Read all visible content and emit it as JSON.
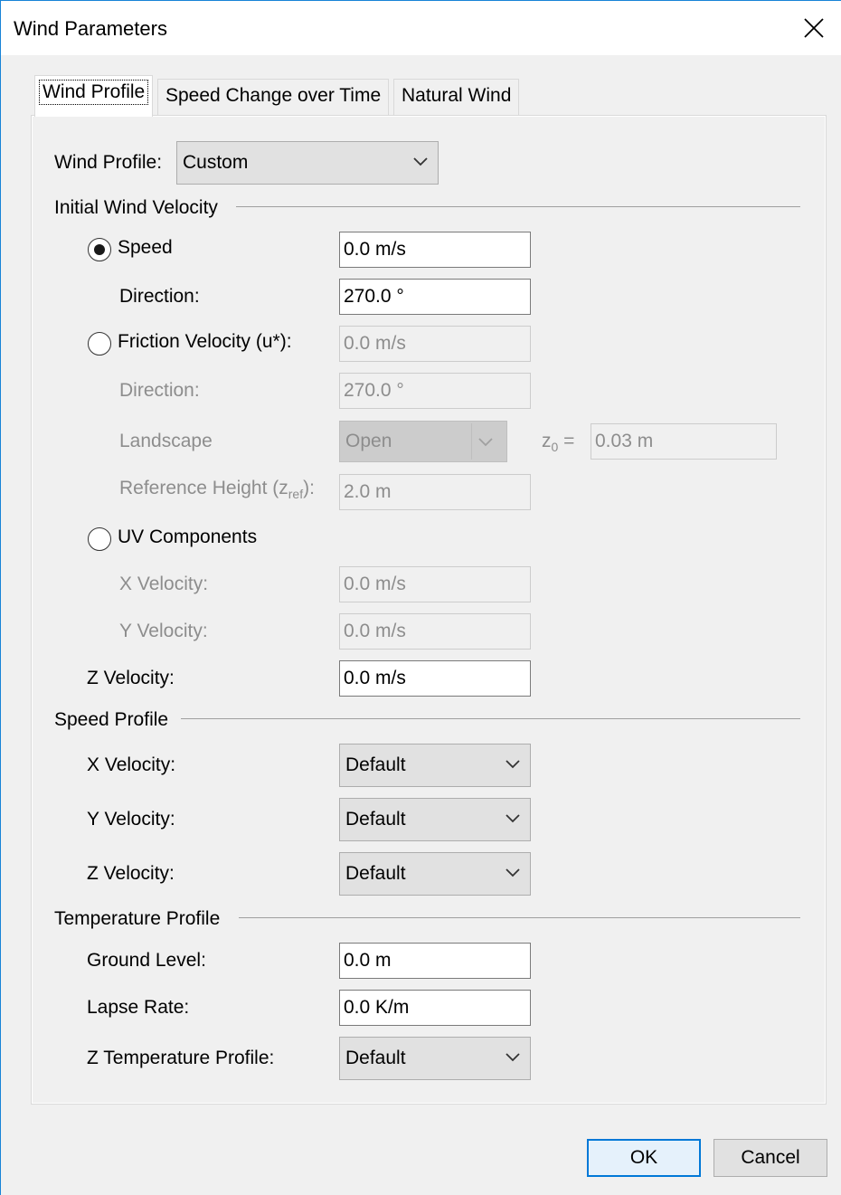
{
  "window": {
    "title": "Wind Parameters",
    "close_icon": "close-icon"
  },
  "tabs": [
    {
      "label": "Wind Profile",
      "active": true
    },
    {
      "label": "Speed Change over Time",
      "active": false
    },
    {
      "label": "Natural Wind",
      "active": false
    }
  ],
  "wind_profile": {
    "label": "Wind Profile:",
    "value": "Custom"
  },
  "initial_velocity": {
    "heading": "Initial Wind Velocity",
    "speed_radio": {
      "label": "Speed",
      "selected": true
    },
    "speed_value": "0.0 m/s",
    "direction_label": "Direction:",
    "direction_value": "270.0 °",
    "friction_radio": {
      "label": "Friction Velocity (u*):",
      "selected": false
    },
    "friction_value": "0.0 m/s",
    "friction_direction_label": "Direction:",
    "friction_direction_value": "270.0 °",
    "landscape_label": "Landscape",
    "landscape_value": "Open",
    "z0_label": "z",
    "z0_sub": "0",
    "z0_eq": "=",
    "z0_value": "0.03 m",
    "ref_height_label": "Reference Height (z",
    "ref_height_sub": "ref",
    "ref_height_close": "):",
    "ref_height_value": "2.0 m",
    "uv_radio": {
      "label": "UV Components",
      "selected": false
    },
    "x_velocity_label": "X Velocity:",
    "x_velocity_value": "0.0 m/s",
    "y_velocity_label": "Y Velocity:",
    "y_velocity_value": "0.0 m/s",
    "z_velocity_label": "Z Velocity:",
    "z_velocity_value": "0.0 m/s"
  },
  "speed_profile": {
    "heading": "Speed Profile",
    "x_label": "X Velocity:",
    "x_value": "Default",
    "y_label": "Y Velocity:",
    "y_value": "Default",
    "z_label": "Z Velocity:",
    "z_value": "Default"
  },
  "temperature_profile": {
    "heading": "Temperature Profile",
    "ground_label": "Ground Level:",
    "ground_value": "0.0 m",
    "lapse_label": "Lapse Rate:",
    "lapse_value": "0.0 K/m",
    "z_temp_label": "Z Temperature Profile:",
    "z_temp_value": "Default"
  },
  "buttons": {
    "ok": "OK",
    "cancel": "Cancel"
  },
  "colors": {
    "accent": "#0078d7",
    "window_border": "#1883d7",
    "disabled_text": "#8d8d8d"
  }
}
